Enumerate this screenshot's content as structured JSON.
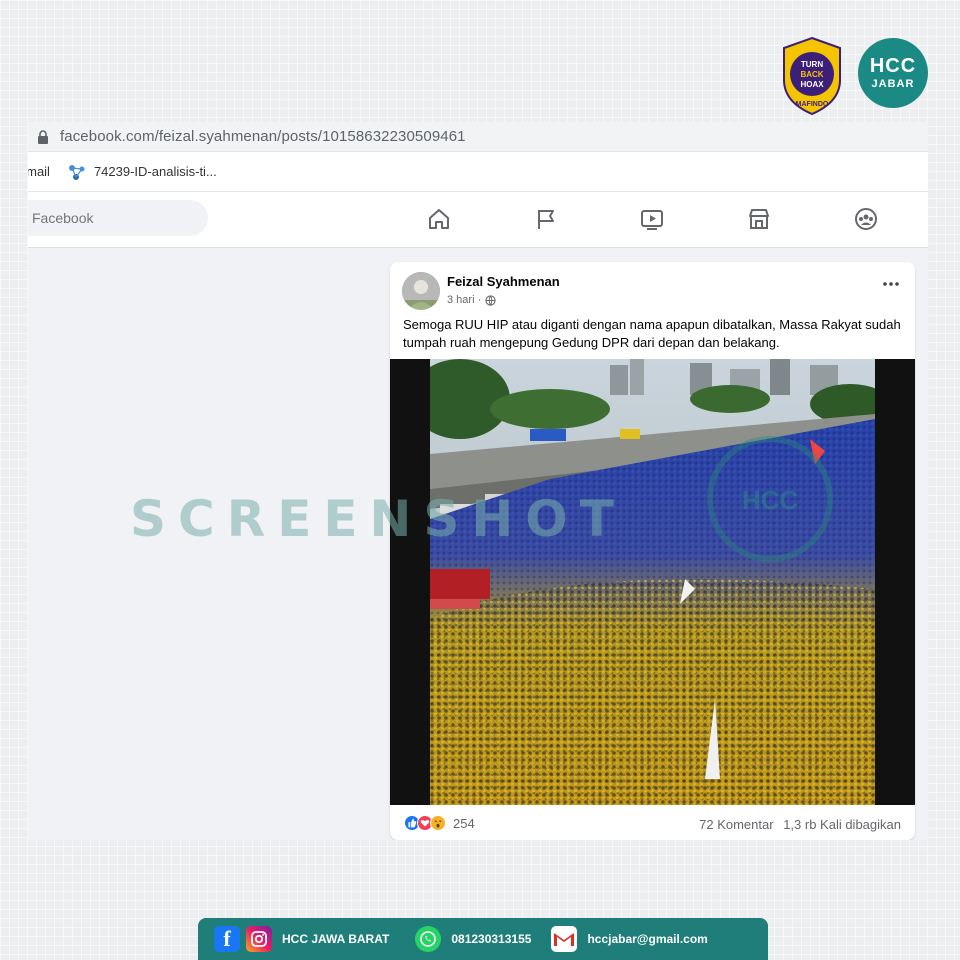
{
  "browser": {
    "url": "facebook.com/feizal.syahmenan/posts/10158632230509461",
    "bookmarks": [
      {
        "label": "Gmail",
        "icon": "gmail-icon"
      },
      {
        "label": "74239-ID-analisis-ti...",
        "icon": "network-icon"
      }
    ]
  },
  "facebook": {
    "search_placeholder": "Facebook",
    "nav": [
      "home-icon",
      "pages-flag-icon",
      "watch-video-icon",
      "marketplace-icon",
      "groups-icon"
    ]
  },
  "post": {
    "author": "Feizal Syahmenan",
    "time": "3 hari",
    "privacy_icon": "globe-icon",
    "text": "Semoga RUU HIP atau diganti dengan nama apapun dibatalkan, Massa Rakyat sudah tumpah ruah mengepung Gedung DPR dari depan dan belakang.",
    "reactions": [
      "like",
      "love",
      "wow"
    ],
    "reaction_count": "254",
    "comments": "72 Komentar",
    "shares": "1,3 rb Kali dibagikan"
  },
  "watermark": "SCREENSHOT",
  "logos": {
    "mafindo_lines": [
      "TURN",
      "BACK",
      "HOAX"
    ],
    "mafindo_label": "MAFINDO",
    "hcc_main": "HCC",
    "hcc_sub": "JABAR"
  },
  "footer": {
    "name": "HCC JAWA BARAT",
    "phone": "081230313155",
    "email": "hccjabar@gmail.com"
  },
  "colors": {
    "teal": "#1f7e7a",
    "facebook_blue": "#1877f2",
    "mafindo_yellow": "#f5c400",
    "mafindo_purple": "#3b1f7a"
  }
}
